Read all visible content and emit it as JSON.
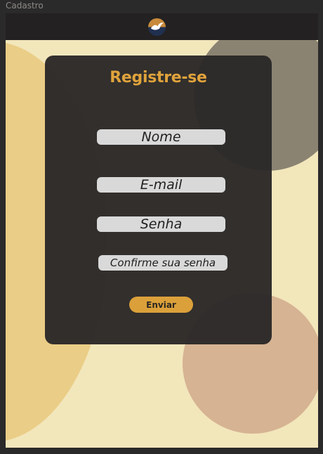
{
  "frame": {
    "label": "Cadastro"
  },
  "header": {
    "logo_icon": "bird-logo-icon"
  },
  "form": {
    "title": "Registre-se",
    "fields": {
      "name_placeholder": "Nome",
      "email_placeholder": "E-mail",
      "password_placeholder": "Senha",
      "confirm_placeholder": "Confirme sua senha"
    },
    "submit_label": "Enviar"
  },
  "colors": {
    "background": "#f2e6bb",
    "card": "#2b2828",
    "accent": "#dba03a",
    "field": "#d9d9d9",
    "blob_left": "#eacd86",
    "blob_top_right": "#8b8372",
    "blob_bottom_right": "#d6b393"
  }
}
